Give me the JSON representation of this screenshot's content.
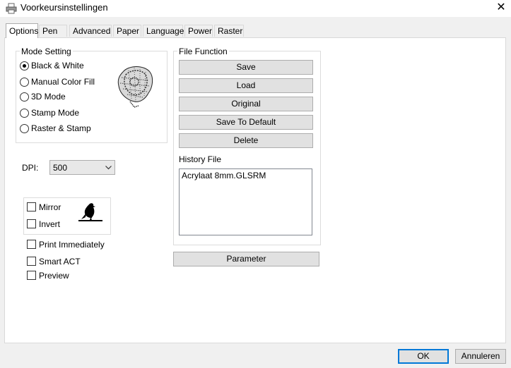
{
  "window": {
    "title": "Voorkeursinstellingen",
    "close_glyph": "✕"
  },
  "tabs": [
    {
      "label": "Options"
    },
    {
      "label": "Pen"
    },
    {
      "label": "Advanced"
    },
    {
      "label": "Paper"
    },
    {
      "label": "Language"
    },
    {
      "label": "Power"
    },
    {
      "label": "Raster"
    }
  ],
  "mode_setting": {
    "legend": "Mode Setting",
    "options": [
      {
        "label": "Black & White",
        "checked": true
      },
      {
        "label": "Manual Color Fill",
        "checked": false
      },
      {
        "label": "3D Mode",
        "checked": false
      },
      {
        "label": "Stamp Mode",
        "checked": false
      },
      {
        "label": "Raster & Stamp",
        "checked": false
      }
    ],
    "preview_icon": "engraved-portrait-icon"
  },
  "dpi": {
    "label": "DPI:",
    "value": "500"
  },
  "transform": {
    "mirror": {
      "label": "Mirror",
      "checked": false
    },
    "invert": {
      "label": "Invert",
      "checked": false
    },
    "preview_icon": "bird-icon"
  },
  "options": {
    "print_immediately": {
      "label": "Print Immediately",
      "checked": false
    },
    "smart_act": {
      "label": "Smart ACT",
      "checked": false
    },
    "preview": {
      "label": "Preview",
      "checked": false
    }
  },
  "file_function": {
    "legend": "File Function",
    "buttons": [
      "Save",
      "Load",
      "Original",
      "Save To Default",
      "Delete"
    ],
    "history_label": "History File",
    "history_items": [
      "Acrylaat 8mm.GLSRM"
    ]
  },
  "parameter_button": "Parameter",
  "footer": {
    "ok": "OK",
    "cancel": "Annuleren"
  }
}
